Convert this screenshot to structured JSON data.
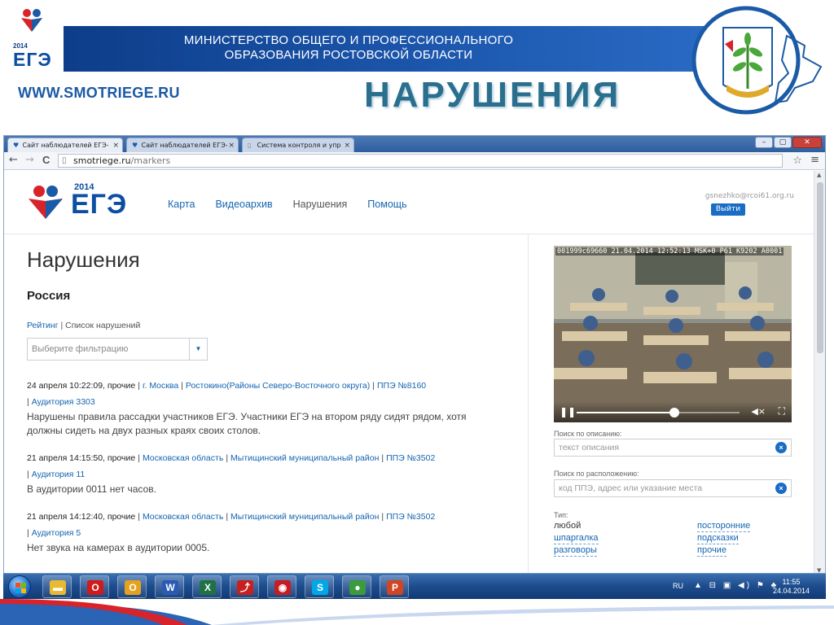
{
  "slide": {
    "ege_logo_year": "2014",
    "ege_logo_word": "ЕГЭ",
    "ministry_line1": "МИНИСТЕРСТВО ОБЩЕГО И ПРОФЕССИОНАЛЬНОГО",
    "ministry_line2": "ОБРАЗОВАНИЯ РОСТОВСКОЙ ОБЛАСТИ",
    "site_url": "WWW.SMOTRIEGE.RU",
    "title": "НАРУШЕНИЯ"
  },
  "browser": {
    "tabs": [
      {
        "label": "Сайт наблюдателей ЕГЭ-",
        "active": true
      },
      {
        "label": "Сайт наблюдателей ЕГЭ-",
        "active": false
      },
      {
        "label": "Система контроля и упр",
        "active": false
      }
    ],
    "tab_close": "×",
    "win_minimize": "–",
    "win_maximize": "▢",
    "win_close": "✕",
    "back_icon": "←",
    "forward_icon": "→",
    "reload_icon": "C",
    "url_host": "smotriege.ru",
    "url_path": "/markers",
    "star_icon": "☆",
    "menu_icon": "≡"
  },
  "site": {
    "logo_year": "2014",
    "logo_word": "ЕГЭ",
    "nav": [
      "Карта",
      "Видеоархив",
      "Нарушения",
      "Помощь"
    ],
    "nav_active_index": 2,
    "user_email": "gsnezhko@rcoi61.org.ru",
    "logout_label": "Выйти"
  },
  "main": {
    "heading": "Нарушения",
    "region": "Россия",
    "link_rating": "Рейтинг",
    "link_separator": "|",
    "link_list": "Список нарушений",
    "filter_placeholder": "Выберите фильтрацию",
    "filter_caret": "▼",
    "violations": [
      {
        "datetime": "24 апреля 10:22:09, прочие",
        "links": [
          "г. Москва",
          "Ростокино(Районы Северо-Восточного округа)",
          "ППЭ №8160",
          "Аудитория 3303"
        ],
        "description": "Нарушены правила рассадки участников ЕГЭ. Участники ЕГЭ на втором ряду сидят рядом, хотя должны сидеть на двух разных краях своих столов."
      },
      {
        "datetime": "21 апреля 14:15:50, прочие",
        "links": [
          "Московская область",
          "Мытищинский муниципальный район",
          "ППЭ №3502",
          "Аудитория 11"
        ],
        "description": "В аудитории 0011 нет часов."
      },
      {
        "datetime": "21 апреля 14:12:40, прочие",
        "links": [
          "Московская область",
          "Мытищинский муниципальный район",
          "ППЭ №3502",
          "Аудитория 5"
        ],
        "description": "Нет звука на камерах в аудитории 0005."
      }
    ]
  },
  "sidebar": {
    "video_overlay": "001999c69660 21.04.2014 12:52:13 MSK+0 P61 K9202 A0001",
    "video_progress": 0.6,
    "pause_icon": "❚❚",
    "volume_icon": "◀×",
    "fullscreen_icon": "⛶",
    "search_desc_label": "Поиск по описанию:",
    "search_desc_placeholder": "текст описания",
    "search_place_label": "Поиск по расположению:",
    "search_place_placeholder": "код ППЭ, адрес или указание места",
    "clear_icon": "×",
    "type_label": "Тип:",
    "types": [
      "любой",
      "посторонние",
      "шпаргалка",
      "подсказки",
      "разговоры",
      "прочие"
    ]
  },
  "taskbar": {
    "apps": [
      {
        "name": "explorer",
        "glyph": "▬",
        "color": "#e8b931"
      },
      {
        "name": "opera",
        "glyph": "O",
        "color": "#d11a1a"
      },
      {
        "name": "outlook",
        "glyph": "O",
        "color": "#e6a21f"
      },
      {
        "name": "word",
        "glyph": "W",
        "color": "#2a5ab3"
      },
      {
        "name": "excel",
        "glyph": "X",
        "color": "#207245"
      },
      {
        "name": "acrobat",
        "glyph": "⤴",
        "color": "#c8201e"
      },
      {
        "name": "app-red",
        "glyph": "◉",
        "color": "#c71c23"
      },
      {
        "name": "skype",
        "glyph": "S",
        "color": "#00a8e8"
      },
      {
        "name": "chrome",
        "glyph": "●",
        "color": "#3c9b3c"
      },
      {
        "name": "powerpoint",
        "glyph": "P",
        "color": "#d14424"
      }
    ],
    "lang": "RU",
    "tray_icons": "▲ ⊟ ▣ ◀) ⚑ ♣",
    "time": "11:55",
    "date": "24.04.2014"
  },
  "colors": {
    "link": "#1565b0",
    "accent_blue": "#0b4ea2",
    "title_teal": "#2a6f8e",
    "logout_bg": "#1a6cc4"
  }
}
